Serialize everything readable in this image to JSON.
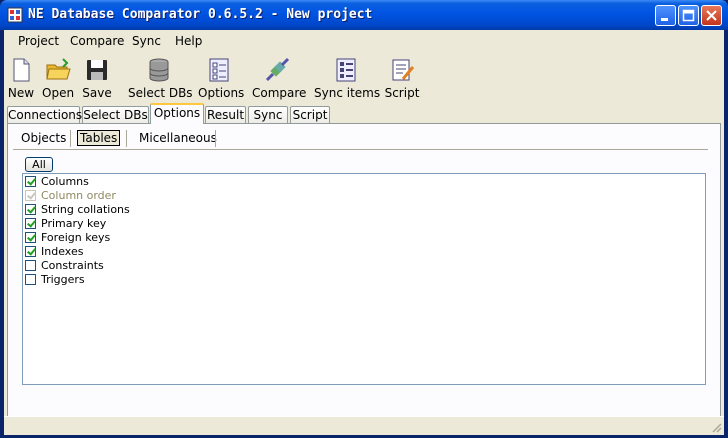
{
  "window": {
    "title": "NE Database Comparator 0.6.5.2 - New project"
  },
  "menu": [
    "Project",
    "Compare",
    "Sync",
    "Help"
  ],
  "toolbar": [
    {
      "label": "New",
      "icon": "new-document-icon"
    },
    {
      "label": "Open",
      "icon": "open-folder-icon"
    },
    {
      "label": "Save",
      "icon": "save-floppy-icon"
    },
    {
      "label": "Select DBs",
      "icon": "database-icon"
    },
    {
      "label": "Options",
      "icon": "options-checklist-icon"
    },
    {
      "label": "Compare",
      "icon": "compare-plug-icon"
    },
    {
      "label": "Sync items",
      "icon": "sync-items-icon"
    },
    {
      "label": "Script",
      "icon": "script-icon"
    }
  ],
  "tabs": [
    "Connections",
    "Select DBs",
    "Options",
    "Result",
    "Sync",
    "Script"
  ],
  "active_tab": "Options",
  "subtabs": [
    "Objects",
    "Tables",
    "Micellaneous"
  ],
  "active_subtab": "Tables",
  "all_button": "All",
  "options": [
    {
      "label": "Columns",
      "checked": true,
      "enabled": true
    },
    {
      "label": "Column order",
      "checked": true,
      "enabled": false
    },
    {
      "label": "String collations",
      "checked": true,
      "enabled": true
    },
    {
      "label": "Primary key",
      "checked": true,
      "enabled": true
    },
    {
      "label": "Foreign keys",
      "checked": true,
      "enabled": true
    },
    {
      "label": "Indexes",
      "checked": true,
      "enabled": true
    },
    {
      "label": "Constraints",
      "checked": false,
      "enabled": true
    },
    {
      "label": "Triggers",
      "checked": false,
      "enabled": true
    }
  ],
  "colors": {
    "titlebar": "#0054e3",
    "face": "#ece9d8",
    "check": "#21a121",
    "active_tab_accent": "#ffc83c"
  }
}
